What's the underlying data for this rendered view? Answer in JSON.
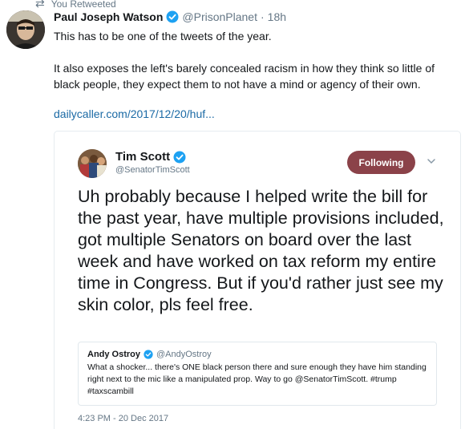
{
  "retweet": {
    "icon": "retweet-icon",
    "label": "You Retweeted"
  },
  "tweet": {
    "author_name": "Paul Joseph Watson",
    "handle": "@PrisonPlanet",
    "separator": "·",
    "time": "18h",
    "paragraph1": "This has to be one of the tweets of the year.",
    "paragraph2": "It also exposes the left's barely concealed racism in how they think so little of black people, they expect them to not have a mind or agency of their own.",
    "link": "dailycaller.com/2017/12/20/huf..."
  },
  "embedded": {
    "author_name": "Tim Scott",
    "handle": "@SenatorTimScott",
    "follow_label": "Following",
    "text": "Uh probably because I helped write the bill for the past year, have multiple provisions included, got multiple Senators on board over the last week and have worked on tax reform my entire time in Congress. But if you'd rather just see my skin color, pls feel free.",
    "timestamp": "4:23 PM - 20 Dec 2017",
    "quote": {
      "author_name": "Andy Ostroy",
      "handle": "@AndyOstroy",
      "text": "What a shocker... there's ONE black person there and sure enough they have him standing right next to the mic like a manipulated prop. Way to go @SenatorTimScott. #trump #taxscambill"
    }
  },
  "colors": {
    "verified": "#1da1f2",
    "link": "#1b6aa5",
    "follow_button": "#8b4249",
    "muted": "#657786"
  }
}
